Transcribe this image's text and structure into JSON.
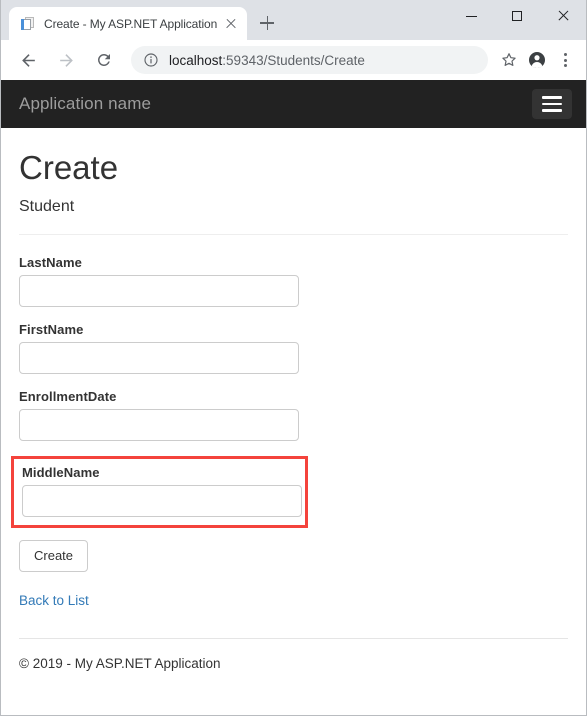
{
  "browser": {
    "tab": {
      "title": "Create - My ASP.NET Application",
      "favicon": "document-page-icon",
      "close_icon": "close-icon"
    },
    "new_tab_icon": "plus-icon",
    "window_controls": {
      "minimize": "minimize-icon",
      "maximize": "maximize-icon",
      "close": "close-icon"
    },
    "nav": {
      "back_icon": "back-arrow-icon",
      "forward_icon": "forward-arrow-icon",
      "reload_icon": "reload-icon"
    },
    "omnibox": {
      "info_icon": "info-circle-icon",
      "host": "localhost",
      "path": ":59343/Students/Create",
      "bookmark_icon": "star-icon",
      "profile_icon": "profile-avatar-icon",
      "menu_icon": "three-dots-menu-icon"
    }
  },
  "site": {
    "navbar": {
      "brand": "Application name",
      "toggle_icon": "hamburger-menu-icon"
    },
    "page": {
      "title": "Create",
      "subtitle": "Student"
    },
    "form": {
      "fields": [
        {
          "label": "LastName",
          "value": "",
          "highlighted": false
        },
        {
          "label": "FirstName",
          "value": "",
          "highlighted": false
        },
        {
          "label": "EnrollmentDate",
          "value": "",
          "highlighted": false
        },
        {
          "label": "MiddleName",
          "value": "",
          "highlighted": true
        }
      ],
      "submit_label": "Create",
      "back_link_label": "Back to List"
    },
    "footer": {
      "copyright": "© 2019 - My ASP.NET Application"
    },
    "colors": {
      "navbar_bg": "#222222",
      "brand_text": "#9d9d9d",
      "highlight_border": "#f4433c",
      "link": "#337ab7"
    }
  }
}
